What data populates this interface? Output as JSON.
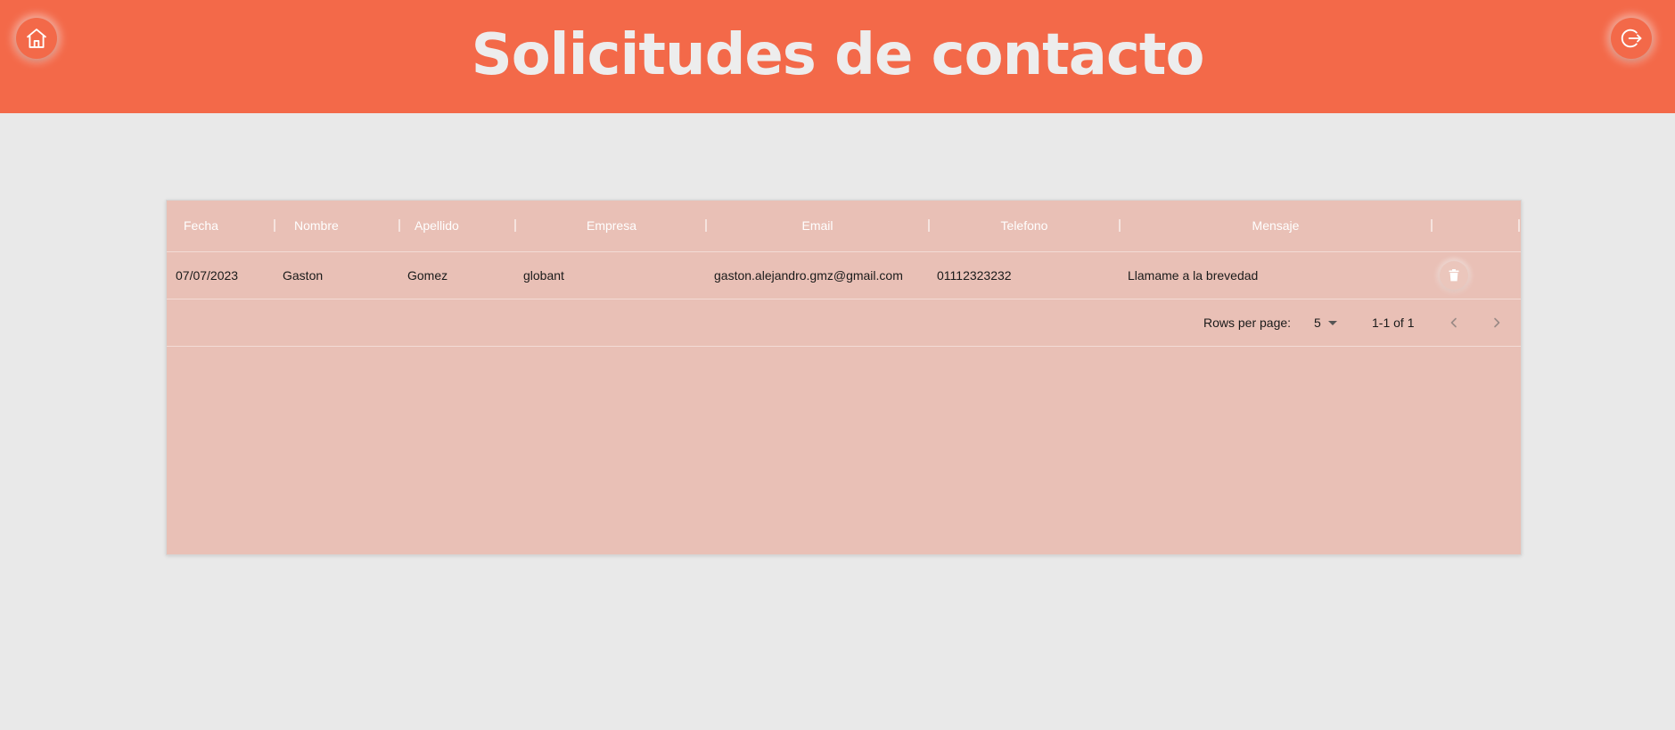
{
  "header": {
    "title": "Solicitudes de contacto",
    "home_icon": "home-icon",
    "logout_icon": "logout-icon"
  },
  "colors": {
    "header_bg": "#f36949",
    "page_bg": "#e9e9e9",
    "table_bg": "#e9c0b6",
    "title_text": "#ededed"
  },
  "table": {
    "columns": [
      "Fecha",
      "Nombre",
      "Apellido",
      "Empresa",
      "Email",
      "Telefono",
      "Mensaje"
    ],
    "rows": [
      {
        "fecha": "07/07/2023",
        "nombre": "Gaston",
        "apellido": "Gomez",
        "empresa": "globant",
        "email": "gaston.alejandro.gmz@gmail.com",
        "telefono": "01112323232",
        "mensaje": "Llamame a la brevedad",
        "action_icon": "trash-icon"
      }
    ]
  },
  "pagination": {
    "rows_per_page_label": "Rows per page:",
    "rows_per_page_value": "5",
    "range_label": "1-1 of 1",
    "prev_icon": "chevron-left-icon",
    "next_icon": "chevron-right-icon"
  }
}
